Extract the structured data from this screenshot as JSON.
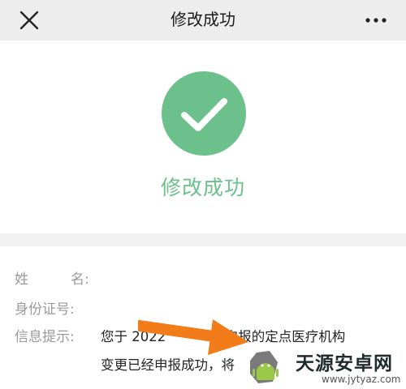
{
  "topbar": {
    "title": "修改成功",
    "close_icon": "close-icon",
    "more_icon": "more-icon"
  },
  "success": {
    "message": "修改成功",
    "icon": "check-circle-icon",
    "accent_color": "#6cc08b"
  },
  "info": {
    "name_label_a": "姓",
    "name_label_b": "名:",
    "id_label": "身份证号:",
    "tip_label": "信息提示:",
    "tip_line1_a": "您于 2022",
    "tip_line1_b": "4申报的定点医疗机构",
    "tip_line2": "变更已经申报成功，将"
  },
  "watermark": {
    "title": "天源安卓网",
    "url": "www.jytyaz.com"
  }
}
